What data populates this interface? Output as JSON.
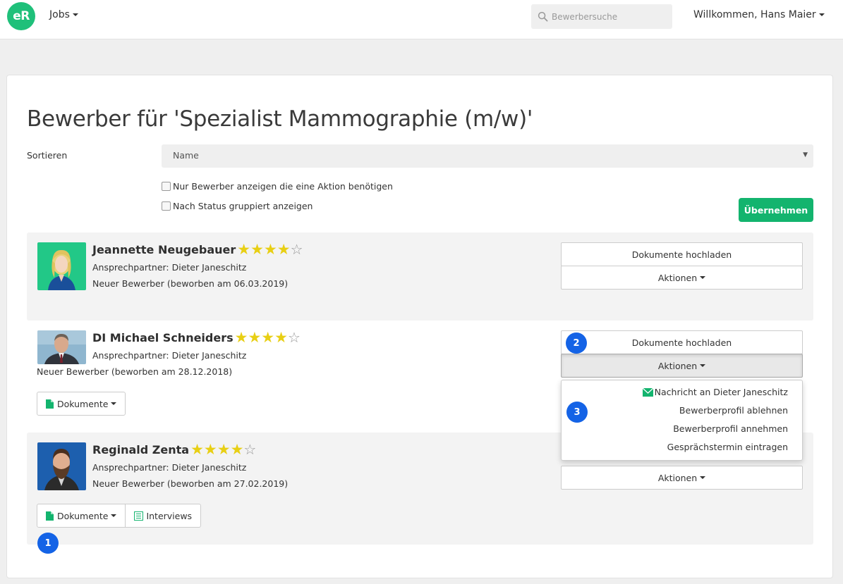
{
  "nav": {
    "logo": "eR",
    "jobs_label": "Jobs",
    "search_placeholder": "Bewerbersuche",
    "user_greeting": "Willkommen, Hans Maier"
  },
  "page": {
    "title": "Bewerber für 'Spezialist Mammographie (m/w)'",
    "sort_label": "Sortieren",
    "sort_value": "Name",
    "filter_action": "Nur Bewerber anzeigen die eine Aktion benötigen",
    "filter_group": "Nach Status gruppiert anzeigen",
    "apply_label": "Übernehmen"
  },
  "candidates": [
    {
      "name": "Jeannette Neugebauer",
      "rating": 4,
      "max_rating": 5,
      "contact": "Ansprechpartner: Dieter Janeschitz",
      "status": "Neuer Bewerber (beworben am 06.03.2019)",
      "upload_label": "Dokumente hochladen",
      "actions_label": "Aktionen"
    },
    {
      "name": "DI Michael Schneiders",
      "rating": 4,
      "max_rating": 5,
      "contact": "Ansprechpartner: Dieter Janeschitz",
      "status": "Neuer Bewerber (beworben am 28.12.2018)",
      "upload_label": "Dokumente hochladen",
      "actions_label": "Aktionen",
      "documents_label": "Dokumente"
    },
    {
      "name": "Reginald Zenta",
      "rating": 4,
      "max_rating": 5,
      "contact": "Ansprechpartner: Dieter Janeschitz",
      "status": "Neuer Bewerber (beworben am 27.02.2019)",
      "actions_label": "Aktionen",
      "documents_label": "Dokumente",
      "interviews_label": "Interviews"
    }
  ],
  "actions_menu": {
    "items": [
      "Nachricht an Dieter Janeschitz",
      "Bewerberprofil ablehnen",
      "Bewerberprofil annehmen",
      "Gesprächstermin eintragen"
    ]
  },
  "markers": [
    "1",
    "2",
    "3"
  ],
  "colors": {
    "brand": "#1fc07a",
    "primary_button": "#13b46e",
    "star": "#e8cf14",
    "marker": "#1463e6"
  }
}
